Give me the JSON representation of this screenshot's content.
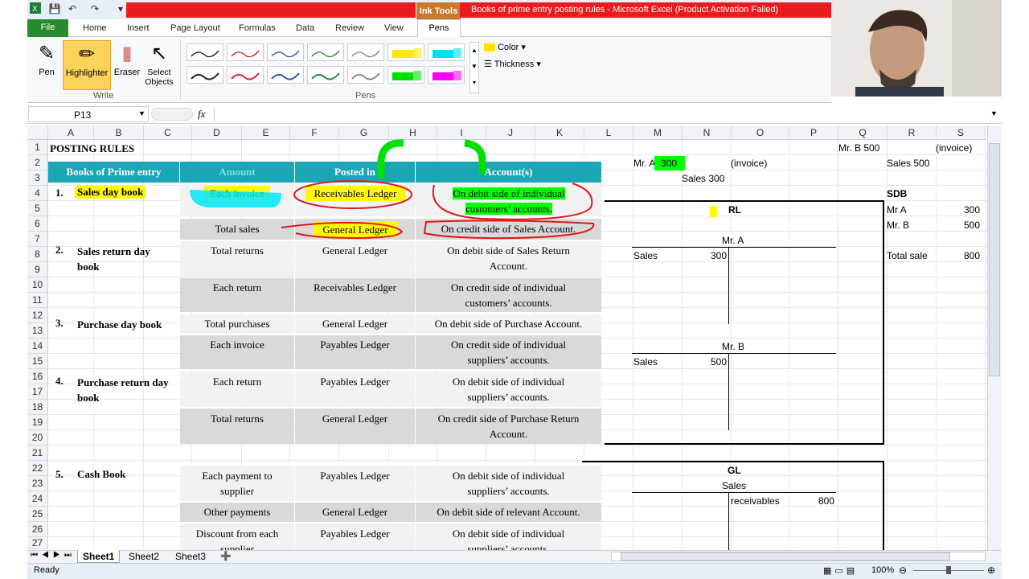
{
  "window": {
    "title": "Books of prime entry posting rules  -  Microsoft Excel (Product Activation Failed)",
    "context_tab": "Ink Tools"
  },
  "tabs": [
    "File",
    "Home",
    "Insert",
    "Page Layout",
    "Formulas",
    "Data",
    "Review",
    "View",
    "Pens"
  ],
  "ribbon": {
    "tools": [
      "Pen",
      "Highlighter",
      "Eraser",
      "Select\nObjects"
    ],
    "groups": {
      "write": "Write",
      "pens": "Pens"
    },
    "color_label": "Color",
    "thickness_label": "Thickness"
  },
  "formula_bar": {
    "name_box": "P13",
    "fx": "fx",
    "content": ""
  },
  "columns": [
    "A",
    "B",
    "C",
    "D",
    "E",
    "F",
    "G",
    "H",
    "I",
    "J",
    "K",
    "L",
    "M",
    "N",
    "O",
    "P",
    "Q",
    "R",
    "S"
  ],
  "rows": [
    "1",
    "2",
    "3",
    "4",
    "5",
    "6",
    "7",
    "8",
    "9",
    "10",
    "11",
    "12",
    "13",
    "14",
    "15",
    "16",
    "17",
    "18",
    "19",
    "20",
    "21",
    "22",
    "23",
    "24",
    "25",
    "26",
    "27"
  ],
  "table": {
    "title": "POSTING RULES",
    "headers": [
      "Books of Prime entry",
      "Amount",
      "Posted in",
      "Account(s)"
    ],
    "sections": [
      {
        "num": "1.",
        "name": "Sales day book",
        "rows": [
          {
            "amount": "Each invoice",
            "posted": "Receivables Ledger",
            "account": "On debit side of individual customers’ accounts."
          },
          {
            "amount": "Total sales",
            "posted": "General Ledger",
            "account": "On credit side of Sales Account."
          }
        ]
      },
      {
        "num": "2.",
        "name": "Sales return day book",
        "rows": [
          {
            "amount": "Total returns",
            "posted": "General Ledger",
            "account": "On debit side of Sales Return Account."
          },
          {
            "amount": "Each return",
            "posted": "Receivables Ledger",
            "account": "On credit side of individual customers’ accounts."
          }
        ]
      },
      {
        "num": "3.",
        "name": "Purchase day book",
        "rows": [
          {
            "amount": "Total purchases",
            "posted": "General Ledger",
            "account": "On debit side of Purchase Account."
          },
          {
            "amount": "Each invoice",
            "posted": "Payables Ledger",
            "account": "On credit side of individual suppliers’ accounts."
          }
        ]
      },
      {
        "num": "4.",
        "name": "Purchase return day book",
        "rows": [
          {
            "amount": "Each return",
            "posted": "Payables Ledger",
            "account": "On debit side of individual suppliers’ accounts."
          },
          {
            "amount": "Total returns",
            "posted": "General Ledger",
            "account": "On credit side of Purchase Return Account."
          }
        ]
      },
      {
        "num": "5.",
        "name": "Cash Book",
        "rows": [
          {
            "amount": "Each payment to supplier",
            "posted": "Payables Ledger",
            "account": "On debit side of individual suppliers’ accounts."
          },
          {
            "amount": "Other payments",
            "posted": "General Ledger",
            "account": "On debit side of relevant Account."
          },
          {
            "amount": "Discount from each supplier",
            "posted": "Payables Ledger",
            "account": "On debit side of individual suppliers’ accounts."
          }
        ]
      }
    ]
  },
  "notes": {
    "mra": "Mr. A",
    "mra_val": "300",
    "invoice1": "(invoice)",
    "sales300": "Sales 300",
    "mrb500": "Mr. B 500",
    "invoice2": "(invoice)",
    "sales500": "Sales 500",
    "sdb": "SDB",
    "sdb_rows": [
      {
        "name": "Mr A",
        "val": "300"
      },
      {
        "name": "Mr. B",
        "val": "500"
      }
    ],
    "total_label": "Total sale",
    "total_val": "800",
    "rl": "RL",
    "mra_acct": "Mr. A",
    "sales": "Sales",
    "v300": "300",
    "mrb_acct": "Mr. B",
    "v500": "500",
    "gl": "GL",
    "sales_acct": "Sales",
    "receivables": "receivables",
    "v800": "800"
  },
  "sheets": [
    "Sheet1",
    "Sheet2",
    "Sheet3"
  ],
  "status": {
    "ready": "Ready",
    "zoom": "100%"
  }
}
